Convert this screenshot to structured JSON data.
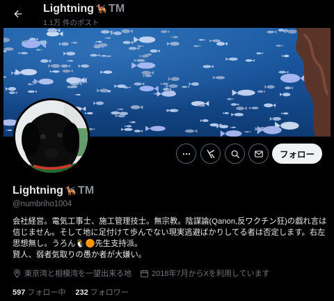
{
  "header": {
    "name": "Lightning",
    "name_emoji": "🐕‍🦺",
    "name_tm": "TM",
    "post_count": "1.1万 件のポスト"
  },
  "profile": {
    "name": "Lightning",
    "name_emoji": "🐕‍🦺",
    "name_tm": "TM",
    "handle": "@numbriho1004",
    "follow_label": "フォロー",
    "bio_lines": [
      "会社経営。電気工事士、施工管理技士。無宗教。陰謀論(Qanon,反ワクチン狂)の戯れ言は",
      "信じません。そして地に足付けて歩んでない現実逃避ばかりしてる者は否定します。右左",
      "思想無し。うろん🐧🟠先生支持派。",
      "賢人、弱者気取りの愚か者が大嫌い。"
    ],
    "location": "東京湾と相模湾を一望出来る地",
    "joined": "2018年7月からXを利用しています",
    "following_count": "597",
    "following_label": "フォロー中",
    "followers_count": "232",
    "followers_label": "フォロワー"
  },
  "icons": {
    "back": "back-arrow-icon",
    "more": "more-icon",
    "grok": "grok-icon",
    "search": "search-icon",
    "message": "envelope-icon",
    "location": "location-pin-icon",
    "calendar": "calendar-icon"
  },
  "colors": {
    "background": "#000000",
    "text_primary": "#e7e9ea",
    "text_secondary": "#71767b",
    "button_border": "#536471",
    "follow_bg": "#eff3f4"
  }
}
